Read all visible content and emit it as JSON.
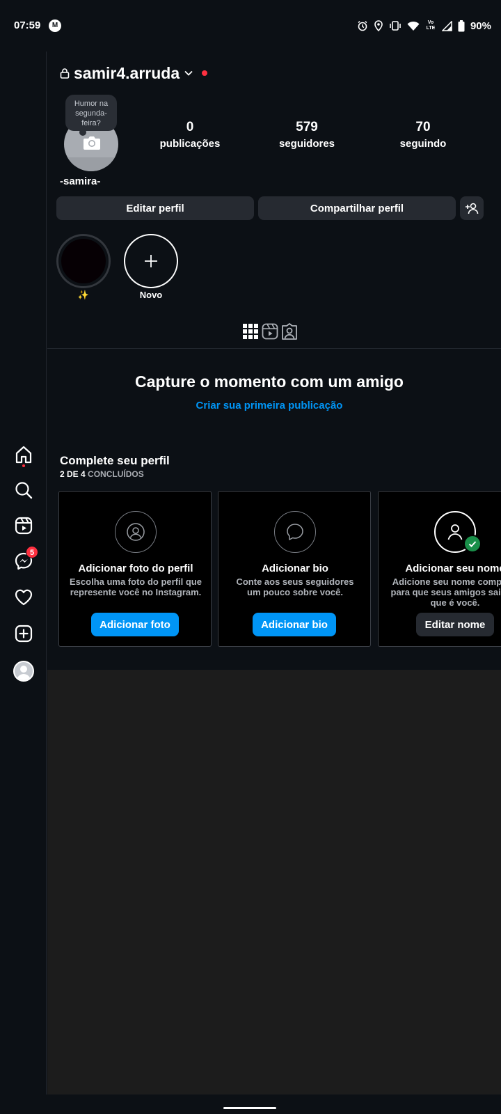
{
  "status_bar": {
    "time": "07:59",
    "carrier_icon": "moto-icon",
    "icons": [
      "alarm-icon",
      "location-icon",
      "vibrate-icon",
      "wifi-icon",
      "volte-icon",
      "signal-icon",
      "battery-icon"
    ],
    "volte_text": "Vo LTE",
    "battery": "90%"
  },
  "side_nav": {
    "items": [
      "home-icon",
      "search-icon",
      "reels-icon",
      "messenger-icon",
      "heart-icon",
      "create-icon",
      "profile-avatar"
    ],
    "messenger_badge": "5"
  },
  "profile": {
    "username": "samir4.arruda",
    "note": "Humor na segunda-feira?",
    "display_name": "-samira-",
    "stats": [
      {
        "value": "0",
        "label": "publicações"
      },
      {
        "value": "579",
        "label": "seguidores"
      },
      {
        "value": "70",
        "label": "seguindo"
      }
    ],
    "edit_button": "Editar perfil",
    "share_button": "Compartilhar perfil"
  },
  "highlights": [
    {
      "label": "✨"
    },
    {
      "label": "Novo"
    }
  ],
  "tabs": [
    "grid-icon",
    "reels-tab-icon",
    "tagged-icon"
  ],
  "empty_state": {
    "title": "Capture o momento com um amigo",
    "link": "Criar sua primeira publicação"
  },
  "complete_profile": {
    "title": "Complete seu perfil",
    "progress": "2 DE 4",
    "progress_suffix": "CONCLUÍDOS",
    "cards": [
      {
        "title": "Adicionar foto do perfil",
        "description": "Escolha uma foto do perfil que represente você no Instagram.",
        "button": "Adicionar foto",
        "done": false
      },
      {
        "title": "Adicionar bio",
        "description": "Conte aos seus seguidores um pouco sobre você.",
        "button": "Adicionar bio",
        "done": false
      },
      {
        "title": "Adicionar seu nome",
        "description": "Adicione seu nome completo para que seus amigos saibam que é você.",
        "button": "Editar nome",
        "done": true
      }
    ]
  },
  "colors": {
    "background": "#0c1015",
    "accent_blue": "#0095f6",
    "notification_red": "#ff3040",
    "success_green": "#1a8f4a"
  }
}
